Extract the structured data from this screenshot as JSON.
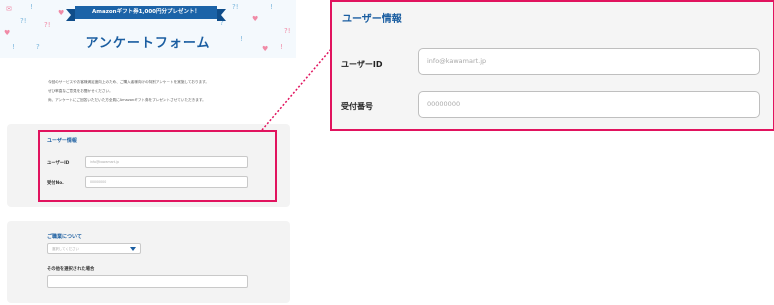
{
  "banner": {
    "ribbon_text": "Amazonギフト券1,000円分プレゼント！",
    "title": "アンケートフォーム"
  },
  "intro": {
    "lines": [
      "今回のサ－ビスやお客様満足度向上のため、ご購入者様向けの特別アンケ－トを実施しております。",
      "ぜひ率直なご意見をお聞かせください。",
      "尚、アンケートにご回答いただいた方全員にAmazonギフト券をプレゼントさせていただきます。"
    ]
  },
  "user_info_small": {
    "section_title": "ユーザー情報",
    "user_id_label": "ユーザーID",
    "user_id_placeholder": "info@kawamart.jp",
    "receipt_label": "受付No.",
    "receipt_placeholder": "00000000"
  },
  "occupation_small": {
    "section_title": "ご職業について",
    "select_placeholder": "選択してください",
    "other_label": "その他を選択された場合"
  },
  "zoom": {
    "section_title": "ユーザー情報",
    "user_id_label": "ユーザーID",
    "user_id_placeholder": "info@kawamart.jp",
    "receipt_label": "受付番号",
    "receipt_placeholder": "00000000"
  },
  "colors": {
    "brand_blue": "#1b5ea1",
    "highlight_pink": "#e1135e",
    "card_bg": "#f3f3f3"
  }
}
